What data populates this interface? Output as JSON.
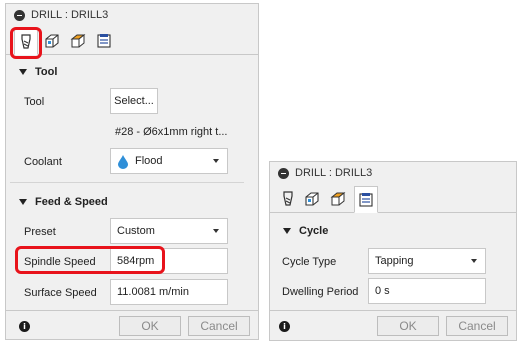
{
  "panel_left": {
    "title": "DRILL : DRILL3",
    "tabs": [
      {
        "icon": "tool-icon",
        "active": true
      },
      {
        "icon": "geometry-icon",
        "active": false
      },
      {
        "icon": "heights-icon",
        "active": false
      },
      {
        "icon": "cycle-icon",
        "active": false
      }
    ],
    "tool_section": {
      "heading": "Tool",
      "tool_label": "Tool",
      "select_button": "Select...",
      "tool_description": "#28 - Ø6x1mm right t...",
      "coolant_label": "Coolant",
      "coolant_value": "Flood"
    },
    "feed_section": {
      "heading": "Feed & Speed",
      "preset_label": "Preset",
      "preset_value": "Custom",
      "spindle_label": "Spindle Speed",
      "spindle_value": "584rpm",
      "surface_label": "Surface Speed",
      "surface_value": "11.0081 m/min"
    },
    "footer": {
      "ok": "OK",
      "cancel": "Cancel",
      "info": "i"
    }
  },
  "panel_right": {
    "title": "DRILL : DRILL3",
    "tabs": [
      {
        "icon": "tool-icon",
        "active": false
      },
      {
        "icon": "geometry-icon",
        "active": false
      },
      {
        "icon": "heights-icon",
        "active": false
      },
      {
        "icon": "cycle-icon",
        "active": true
      }
    ],
    "cycle_section": {
      "heading": "Cycle",
      "cycle_type_label": "Cycle Type",
      "cycle_type_value": "Tapping",
      "dwell_label": "Dwelling Period",
      "dwell_value": "0 s"
    },
    "footer": {
      "ok": "OK",
      "cancel": "Cancel",
      "info": "i"
    }
  },
  "colors": {
    "highlight": "#e8131b",
    "coolant_drop": "#2f8fd8",
    "heights_tab_fill": "#f0a020",
    "cycle_tab_blue": "#2a4fa0"
  }
}
